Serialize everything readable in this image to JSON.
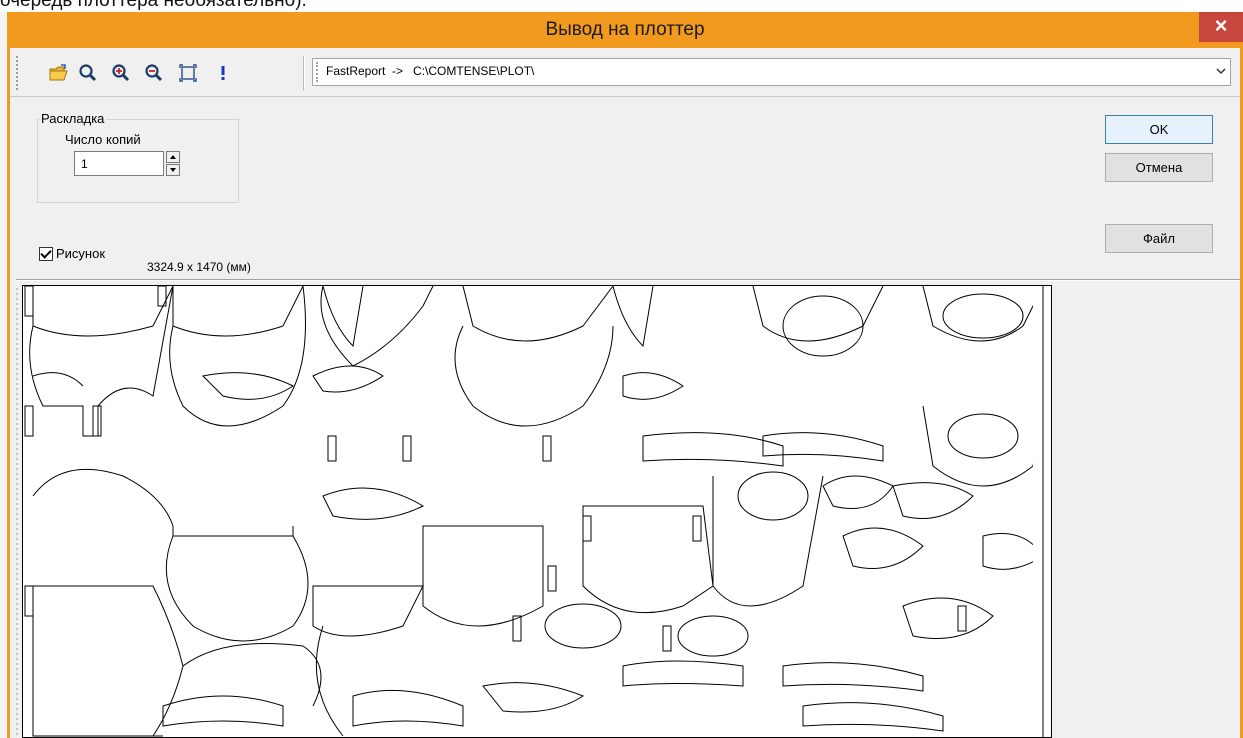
{
  "background_text": "очередь плоттера необязательно).",
  "window": {
    "title": "Вывод на плоттер",
    "close_label": "×",
    "accent_color": "#f29a1e"
  },
  "toolbar": {
    "icons": [
      "open-folder-icon",
      "zoom-icon",
      "zoom-in-icon",
      "zoom-out-icon",
      "fit-page-icon",
      "exclamation-icon"
    ],
    "output_combo_value": "FastReport  ->   C:\\COMTENSE\\PLOT\\"
  },
  "layout_group": {
    "legend": "Раскладка",
    "copies_label": "Число копий",
    "copies_value": "1"
  },
  "picture": {
    "checkbox_label": "Рисунок",
    "checked": true,
    "dimensions": "3324.9 x 1470 (мм)"
  },
  "buttons": {
    "ok": "OK",
    "cancel": "Отмена",
    "file": "Файл"
  }
}
